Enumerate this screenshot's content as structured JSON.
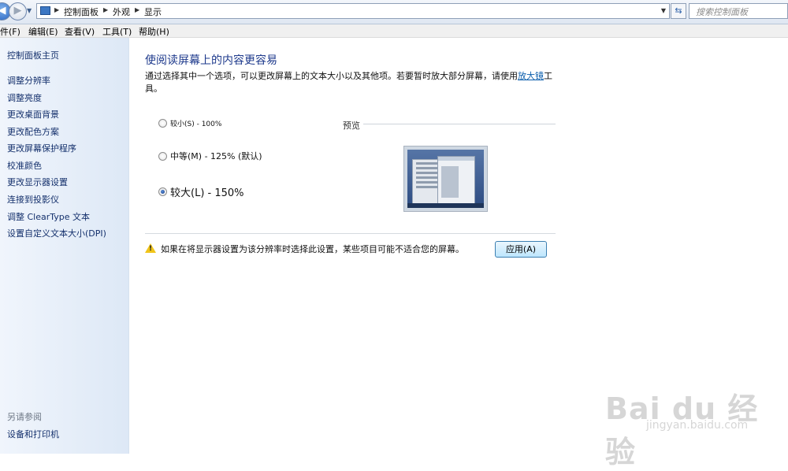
{
  "addressbar": {
    "crumbs": [
      "控制面板",
      "外观",
      "显示"
    ],
    "search_placeholder": "搜索控制面板"
  },
  "menu": [
    "件(F)",
    "编辑(E)",
    "查看(V)",
    "工具(T)",
    "帮助(H)"
  ],
  "sidebar": {
    "home": "控制面板主页",
    "links": [
      "调整分辨率",
      "调整亮度",
      "更改桌面背景",
      "更改配色方案",
      "更改屏幕保护程序",
      "校准颜色",
      "更改显示器设置",
      "连接到投影仪",
      "调整 ClearType 文本",
      "设置自定义文本大小(DPI)"
    ],
    "see_also": "另请参阅",
    "see_also_link": "设备和打印机"
  },
  "main": {
    "title": "使阅读屏幕上的内容更容易",
    "desc_before": "通过选择其中一个选项，可以更改屏幕上的文本大小以及其他项。若要暂时放大部分屏幕，请使用",
    "desc_link": "放大镜",
    "desc_after": "工具。",
    "options": [
      {
        "label": "较小(S) - 100%",
        "selected": false
      },
      {
        "label": "中等(M) - 125% (默认)",
        "selected": false
      },
      {
        "label": "较大(L) - 150%",
        "selected": true
      }
    ],
    "preview_label": "预览",
    "warning": "如果在将显示器设置为该分辨率时选择此设置，某些项目可能不适合您的屏幕。",
    "apply_button": "应用(A)"
  },
  "watermark": {
    "logo": "Bai du 经验",
    "sub": "jingyan.baidu.com"
  }
}
